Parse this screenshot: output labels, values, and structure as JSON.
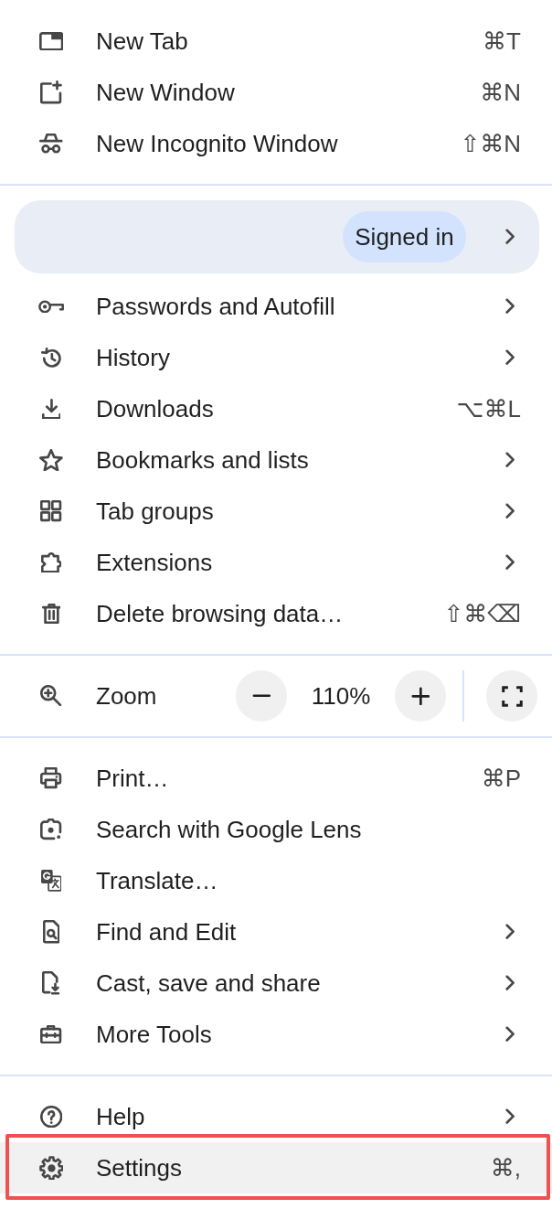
{
  "menu": {
    "sections": [
      {
        "items": [
          {
            "label": "New Tab",
            "shortcut": "⌘T",
            "submenu": false,
            "highlighted": false
          },
          {
            "label": "New Window",
            "shortcut": "⌘N",
            "submenu": false,
            "highlighted": false
          },
          {
            "label": "New Incognito Window",
            "shortcut": "⇧⌘N",
            "submenu": false,
            "highlighted": false
          }
        ]
      },
      {
        "profile_card": {
          "status": "Signed in"
        },
        "items": [
          {
            "label": "Passwords and Autofill",
            "submenu": true,
            "highlighted": false
          },
          {
            "label": "History",
            "submenu": true,
            "highlighted": false
          },
          {
            "label": "Downloads",
            "shortcut": "⌥⌘L",
            "submenu": false,
            "highlighted": false
          },
          {
            "label": "Bookmarks and lists",
            "submenu": true,
            "highlighted": false
          },
          {
            "label": "Tab groups",
            "submenu": true,
            "highlighted": false
          },
          {
            "label": "Extensions",
            "submenu": true,
            "highlighted": false
          },
          {
            "label": "Delete browsing data…",
            "shortcut": "⇧⌘⌫",
            "submenu": false,
            "highlighted": false
          }
        ]
      },
      {
        "zoom_control": {
          "label": "Zoom",
          "value": "110%"
        }
      },
      {
        "items": [
          {
            "label": "Print…",
            "shortcut": "⌘P",
            "submenu": false,
            "highlighted": false
          },
          {
            "label": "Search with Google Lens",
            "submenu": false,
            "highlighted": false
          },
          {
            "label": "Translate…",
            "submenu": false,
            "highlighted": false
          },
          {
            "label": "Find and Edit",
            "submenu": true,
            "highlighted": false
          },
          {
            "label": "Cast, save and share",
            "submenu": true,
            "highlighted": false
          },
          {
            "label": "More Tools",
            "submenu": true,
            "highlighted": false
          }
        ]
      },
      {
        "items": [
          {
            "label": "Help",
            "submenu": true,
            "highlighted": false
          },
          {
            "label": "Settings",
            "shortcut": "⌘,",
            "submenu": false,
            "highlighted": true
          }
        ]
      }
    ]
  }
}
